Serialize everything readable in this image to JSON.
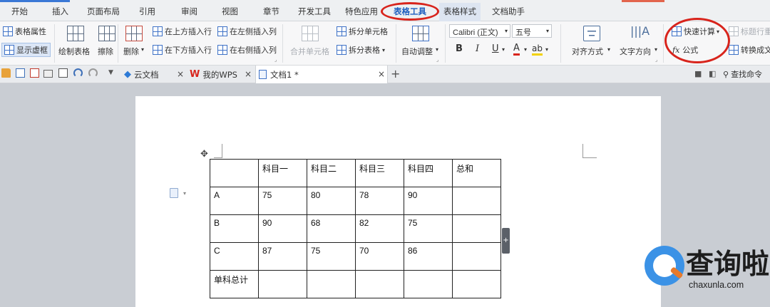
{
  "menu": {
    "tabs": [
      "开始",
      "插入",
      "页面布局",
      "引用",
      "审阅",
      "视图",
      "章节",
      "开发工具",
      "特色应用",
      "表格工具",
      "表格样式",
      "文档助手"
    ],
    "active_tab": "表格工具",
    "accent_color": "#3a78d6",
    "highlight_color": "#d8241c"
  },
  "ribbon": {
    "table_props": "表格属性",
    "show_gridlines": "显示虚框",
    "draw_table": "绘制表格",
    "eraser": "擦除",
    "delete": "删除",
    "insert_row_above": "在上方插入行",
    "insert_row_below": "在下方插入行",
    "insert_col_left": "在左侧插入列",
    "insert_col_right": "在右侧插入列",
    "merge_cells": "合并单元格",
    "split_cells": "拆分单元格",
    "split_table": "拆分表格",
    "auto_fit": "自动调整",
    "font_name": "Calibri (正文)",
    "font_size": "五号",
    "bold": "B",
    "italic": "I",
    "underline": "U",
    "font_color": "A",
    "highlight": "ab",
    "alignment": "对齐方式",
    "text_direction": "文字方向",
    "quick_calc": "快速计算",
    "title_row_repeat": "标题行重",
    "formula_prefix": "fx",
    "formula": "公式",
    "convert_to_text": "转换成文"
  },
  "tabbar": {
    "tabs": [
      {
        "label": "云文档",
        "icon": "cloud-doc-icon"
      },
      {
        "label": "我的WPS",
        "icon": "wps-logo-icon"
      },
      {
        "label": "文档1 *",
        "icon": "document-icon"
      }
    ],
    "close_glyph": "×",
    "add_glyph": "+",
    "search_label": "查找命令"
  },
  "table": {
    "headers": [
      "",
      "科目一",
      "科目二",
      "科目三",
      "科目四",
      "总和"
    ],
    "rows": [
      [
        "A",
        "75",
        "80",
        "78",
        "90",
        ""
      ],
      [
        "B",
        "90",
        "68",
        "82",
        "75",
        ""
      ],
      [
        "C",
        "87",
        "75",
        "70",
        "86",
        ""
      ],
      [
        "单科总计",
        "",
        "",
        "",
        "",
        ""
      ]
    ]
  },
  "watermark": {
    "text": "查询啦",
    "url": "chaxunla.com",
    "blue": "#3b92e6",
    "orange": "#e67a2c"
  }
}
